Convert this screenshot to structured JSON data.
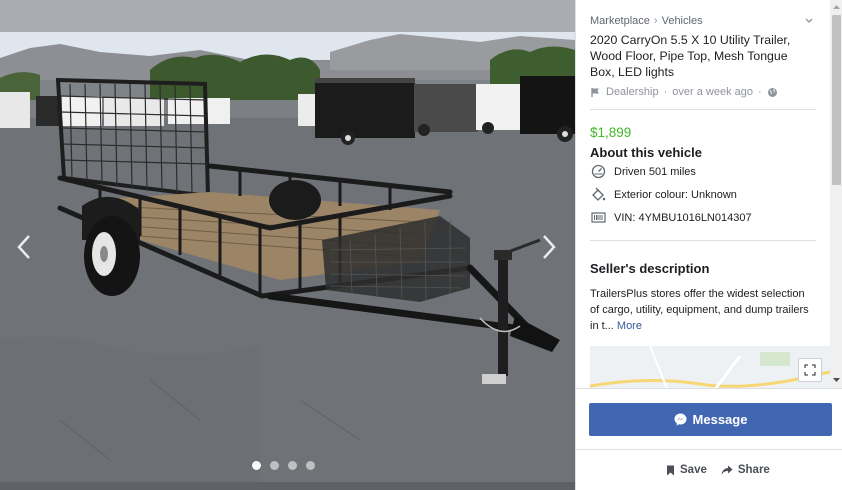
{
  "photo": {
    "alt": "Black utility trailer with wood floor on asphalt lot",
    "slides": 4,
    "active_slide": 1
  },
  "listing": {
    "breadcrumb": [
      "Marketplace",
      "Vehicles"
    ],
    "title": "2020 CarryOn 5.5 X 10 Utility Trailer, Wood Floor, Pipe Top, Mesh Tongue Box, LED lights",
    "seller_type": "Dealership",
    "posted": "over a week ago",
    "price": "$1,899",
    "about_heading": "About this vehicle",
    "attributes": [
      {
        "icon": "speedometer-icon",
        "text": "Driven 501 miles"
      },
      {
        "icon": "paint-bucket-icon",
        "text": "Exterior colour: Unknown"
      },
      {
        "icon": "barcode-icon",
        "text": "VIN: 4YMBU1016LN014307"
      }
    ],
    "description_heading": "Seller's description",
    "description": "TrailersPlus stores offer the widest selection of cargo, utility, equipment, and dump trailers in t...",
    "more_label": "More"
  },
  "actions": {
    "message_label": "Message",
    "save_label": "Save",
    "share_label": "Share"
  },
  "colors": {
    "price": "#42b72a",
    "primary_button": "#4267b2",
    "link": "#385898"
  }
}
